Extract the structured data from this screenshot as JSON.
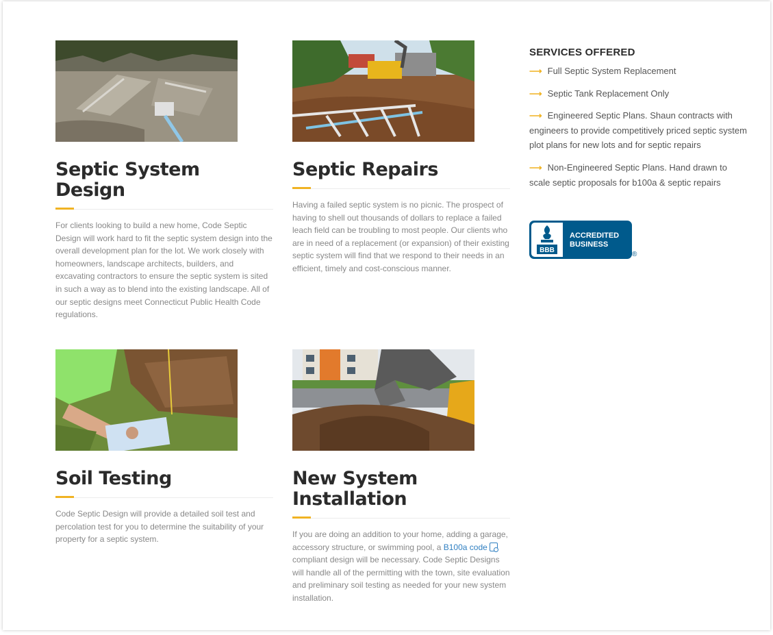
{
  "cards": [
    {
      "title": "Septic System Design",
      "body": "For clients looking to build a new home, Code Septic Design will work hard to fit the septic system design into the overall development plan for the lot. We work closely with homeowners, landscape architects, builders, and excavating contractors to ensure the septic system is sited in such a way as to blend into the existing landscape. All of our septic designs meet Connecticut Public Health Code regulations."
    },
    {
      "title": "Septic Repairs",
      "body": "Having a failed septic system is no picnic. The prospect of having to shell out thousands of dollars to replace a failed leach field can be troubling to most people. Our clients who are in need of a replacement (or expansion) of their existing septic system will find that we respond to their needs in an efficient, timely and cost-conscious manner."
    },
    {
      "title": "Soil Testing",
      "body": "Code Septic Design will provide a detailed soil test and percolation test for you to determine the suitability of your property for a septic system."
    },
    {
      "title": "New System Installation",
      "body_before": "If you are doing an addition to your home, adding a garage, accessory structure, or swimming pool, a ",
      "link_text": "B100a code",
      "body_after": " compliant design will be necessary. Code Septic Designs will handle all of the permitting with the town, site evaluation and preliminary soil testing as needed for your new system installation."
    }
  ],
  "services": {
    "heading": "SERVICES OFFERED",
    "items": [
      "Full Septic System Replacement",
      "Septic Tank Replacement Only",
      "Engineered Septic Plans. Shaun contracts with engineers to provide competitively priced septic system plot plans for new lots and for septic repairs",
      "Non-Engineered Septic Plans. Hand drawn to scale septic proposals for b100a & septic repairs"
    ],
    "arrow": "⟶"
  },
  "bbb": {
    "logo_text": "BBB",
    "line1": "ACCREDITED",
    "line2": "BUSINESS",
    "reg": "®"
  },
  "colors": {
    "accent": "#f0b323",
    "link": "#2f7fc1",
    "bbb_blue": "#005a8c"
  }
}
